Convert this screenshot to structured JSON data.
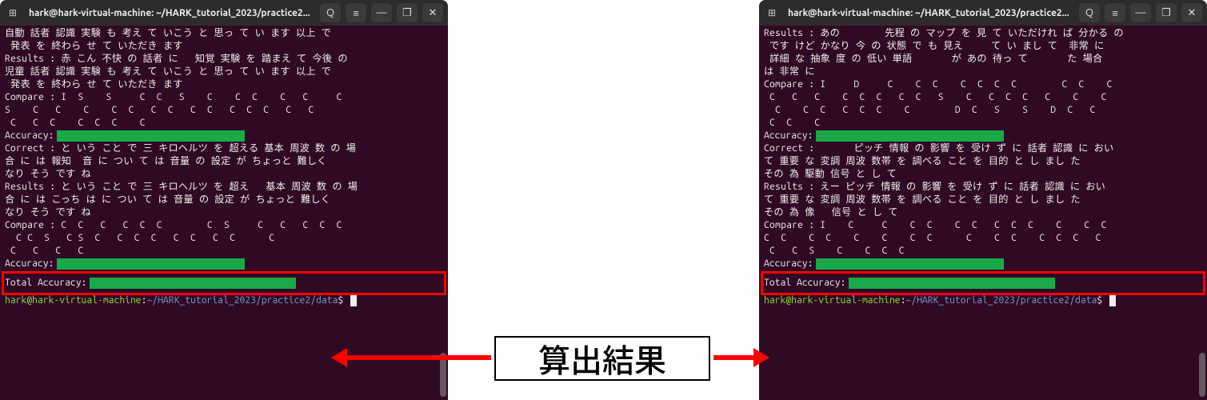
{
  "center_label": "算出結果",
  "terminal_left": {
    "title": "hark@hark-virtual-machine: ~/HARK_tutorial_2023/practice2...",
    "lines": [
      "自動 話者 認識 実験 も 考え て いこう と 思っ て い ます 以上 で",
      " 発表 を 終わら せ て いただき ます",
      "Results : 赤 こん 不快 の 話者 に   知覚 実験 を 踏まえ て 今後 の ",
      "児童 話者 認識 実験 も 考え て いこう と 思っ て い ます 以上 で",
      " 発表 を 終わら せ て いただき ます",
      "Compare : I  S    S     C  C   S    C    C  C    C   C     C ",
      "S    C   C    C    C  C   C  C   C  C   C  C  C   C   C ",
      " C   C  C    C  C  C    C ",
      "__ACCURACY__",
      "",
      "Correct : と いう こと で 三 キロヘルツ を 超える 基本 周波 数 の 場",
      "合 に は 報知  音 に つい て は 音量 の 設定 が ちょっと 難しく ",
      "なり そう です ね",
      "Results : と いう こと で 三 キロヘルツ を 超え   基本 周波 数 の 場",
      "合 に は こっち は に つい て は 音量 の 設定 が ちょっと 難しく ",
      "なり そう です ね",
      "Compare : C  C   C   C  C  C        C  S     C   C   C  C  C",
      "  C C  S   C S  C   C  C  C   C  C   C  C      C   ",
      " C   C   C   C",
      "__ACCURACY__",
      "",
      "__TOTAL__"
    ],
    "accuracy_label": "Accuracy:",
    "total_label": "Total Accuracy:",
    "prompt_user": "hark@hark-virtual-machine",
    "prompt_path": "~/HARK_tutorial_2023/practice2/data",
    "prompt_symbol": "$"
  },
  "terminal_right": {
    "title": "hark@hark-virtual-machine: ~/HARK_tutorial_2023/practice2...",
    "lines": [
      "Results : あの        先程 の マップ を 見 て いただけれ ば 分かる の ",
      " です けど かなり 今 の 状態 で も 見え     て い まし て  非常 に ",
      " 詳細 な 抽象 度 の 低い 単語       が あの 待っ て       た 場合 ",
      "は 非常 に",
      "Compare : I     D     C    C  C    C  C  C  C        C  C    C ",
      " C   C   C    C  C  C   C  C   S    C   C  C  C   C    C    C",
      "  C    C  C   C  C  C    C        D  C   S    S    D  C   C ",
      " C  C    C ",
      "__ACCURACY__",
      "",
      "Correct :       ピッチ 情報 の 影響 を 受け ず に 話者 認識 に おい ",
      "て 重要 な 変調 周波 数帯 を 調べる こと を 目的 と し まし た ",
      "その 為 駆動 信号 と し て",
      "Results : えー ピッチ 情報 の 影響 を 受け ず に 話者 認識 に おい ",
      "て 重要 な 変調 周波 数帯 を 調べる こと を 目的 と し まし た ",
      "その 為 像   信号 と し て",
      "Compare : I    C     C    C  C    C  C   C  C  C    C    C  C   ",
      "C  C    C  C    C    C    C  C      C    C  C    C  C  C   C ",
      " C   C  S    C    C  C  C",
      "__ACCURACY__",
      "",
      "__TOTAL__"
    ],
    "accuracy_label": "Accuracy:",
    "total_label": "Total Accuracy:",
    "prompt_user": "hark@hark-virtual-machine",
    "prompt_path": "~/HARK_tutorial_2023/practice2/data",
    "prompt_symbol": "$"
  },
  "icons": {
    "newtab": "⊞",
    "search": "Q",
    "menu": "≡",
    "minimize": "—",
    "maximize": "❐",
    "close": "✕"
  }
}
